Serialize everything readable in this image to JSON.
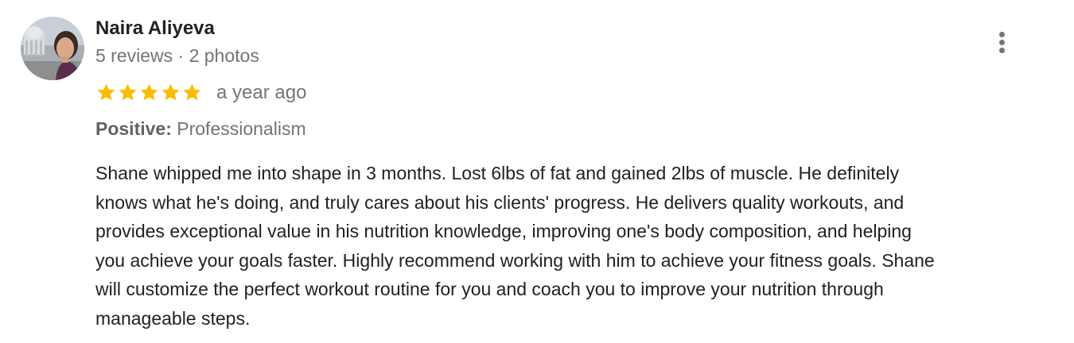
{
  "review": {
    "author": "Naira Aliyeva",
    "meta": "5 reviews · 2 photos",
    "rating": 5,
    "max_rating": 5,
    "time": "a year ago",
    "attribute_label": "Positive:",
    "attribute_value": "Professionalism",
    "text_lines": [
      "Shane whipped me into shape in 3 months. Lost 6lbs of fat and gained 2lbs of muscle. He definitely",
      "knows what he's doing, and truly cares about his clients' progress. He delivers quality workouts, and",
      "provides exceptional value in his nutrition knowledge, improving one's body composition, and helping",
      "you achieve your goals faster. Highly recommend working with him to achieve your fitness goals. Shane",
      "will customize the perfect workout routine for you and coach you to improve your nutrition through",
      "manageable steps."
    ]
  },
  "icons": {
    "star": "star-icon",
    "more": "more-vert-icon"
  },
  "colors": {
    "star": "#fbbc04",
    "name": "#202124",
    "secondary": "#70757a"
  }
}
